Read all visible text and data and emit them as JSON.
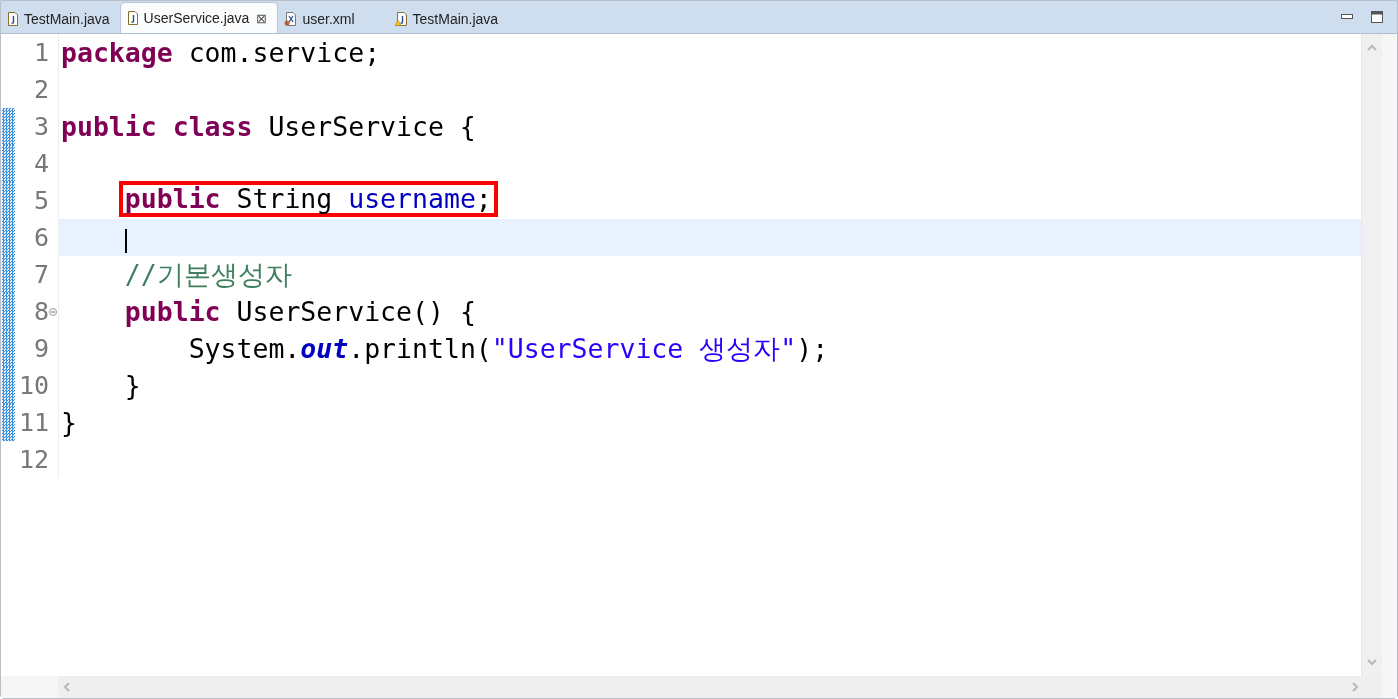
{
  "tabs": [
    {
      "label": "TestMain.java",
      "kind": "java",
      "selected": false
    },
    {
      "label": "UserService.java",
      "kind": "java",
      "selected": true,
      "close": "⊠"
    },
    {
      "label": "user.xml",
      "kind": "xml",
      "selected": false
    },
    {
      "label": "TestMain.java",
      "kind": "java-warning",
      "selected": false
    }
  ],
  "editor": {
    "lines": [
      {
        "number": "1",
        "changed": false,
        "current": false,
        "annotated": false,
        "fold": false,
        "segments": [
          {
            "text": "package",
            "kind": "keyword"
          },
          {
            "text": " com.service;",
            "kind": "plain"
          }
        ]
      },
      {
        "number": "2",
        "changed": false,
        "current": false,
        "annotated": false,
        "fold": false
      },
      {
        "number": "3",
        "changed": true,
        "current": false,
        "annotated": false,
        "fold": false,
        "segments": [
          {
            "text": "public class",
            "kind": "keyword"
          },
          {
            "text": " UserService {",
            "kind": "plain"
          }
        ]
      },
      {
        "number": "4",
        "changed": true,
        "current": false,
        "annotated": false,
        "fold": false
      },
      {
        "number": "5",
        "changed": true,
        "current": false,
        "annotated": true,
        "fold": false,
        "segments": [
          {
            "text": "    public",
            "kind": "keyword"
          },
          {
            "text": " String ",
            "kind": "plain"
          },
          {
            "text": "username",
            "kind": "field"
          },
          {
            "text": ";",
            "kind": "plain"
          }
        ]
      },
      {
        "number": "6",
        "changed": true,
        "current": true,
        "annotated": false,
        "fold": false
      },
      {
        "number": "7",
        "changed": true,
        "current": false,
        "annotated": false,
        "fold": false,
        "segments": [
          {
            "text": "    //기본생성자",
            "kind": "comment"
          }
        ]
      },
      {
        "number": "8",
        "changed": true,
        "current": false,
        "annotated": false,
        "fold": true,
        "segments": [
          {
            "text": "    public",
            "kind": "keyword"
          },
          {
            "text": " UserService() {",
            "kind": "plain"
          }
        ]
      },
      {
        "number": "9",
        "changed": true,
        "current": false,
        "annotated": false,
        "fold": false,
        "segments": [
          {
            "text": "        System.",
            "kind": "plain"
          },
          {
            "text": "out",
            "kind": "static"
          },
          {
            "text": ".println(",
            "kind": "plain"
          },
          {
            "text": "\"UserService 생성자\"",
            "kind": "string"
          },
          {
            "text": ");",
            "kind": "plain"
          }
        ]
      },
      {
        "number": "10",
        "changed": true,
        "current": false,
        "annotated": false,
        "fold": false,
        "segments": [
          {
            "text": "    }",
            "kind": "plain"
          }
        ]
      },
      {
        "number": "11",
        "changed": true,
        "current": false,
        "annotated": false,
        "fold": false,
        "segments": [
          {
            "text": "}",
            "kind": "plain"
          }
        ]
      },
      {
        "number": "12",
        "changed": false,
        "current": false,
        "annotated": false,
        "fold": false
      }
    ]
  }
}
